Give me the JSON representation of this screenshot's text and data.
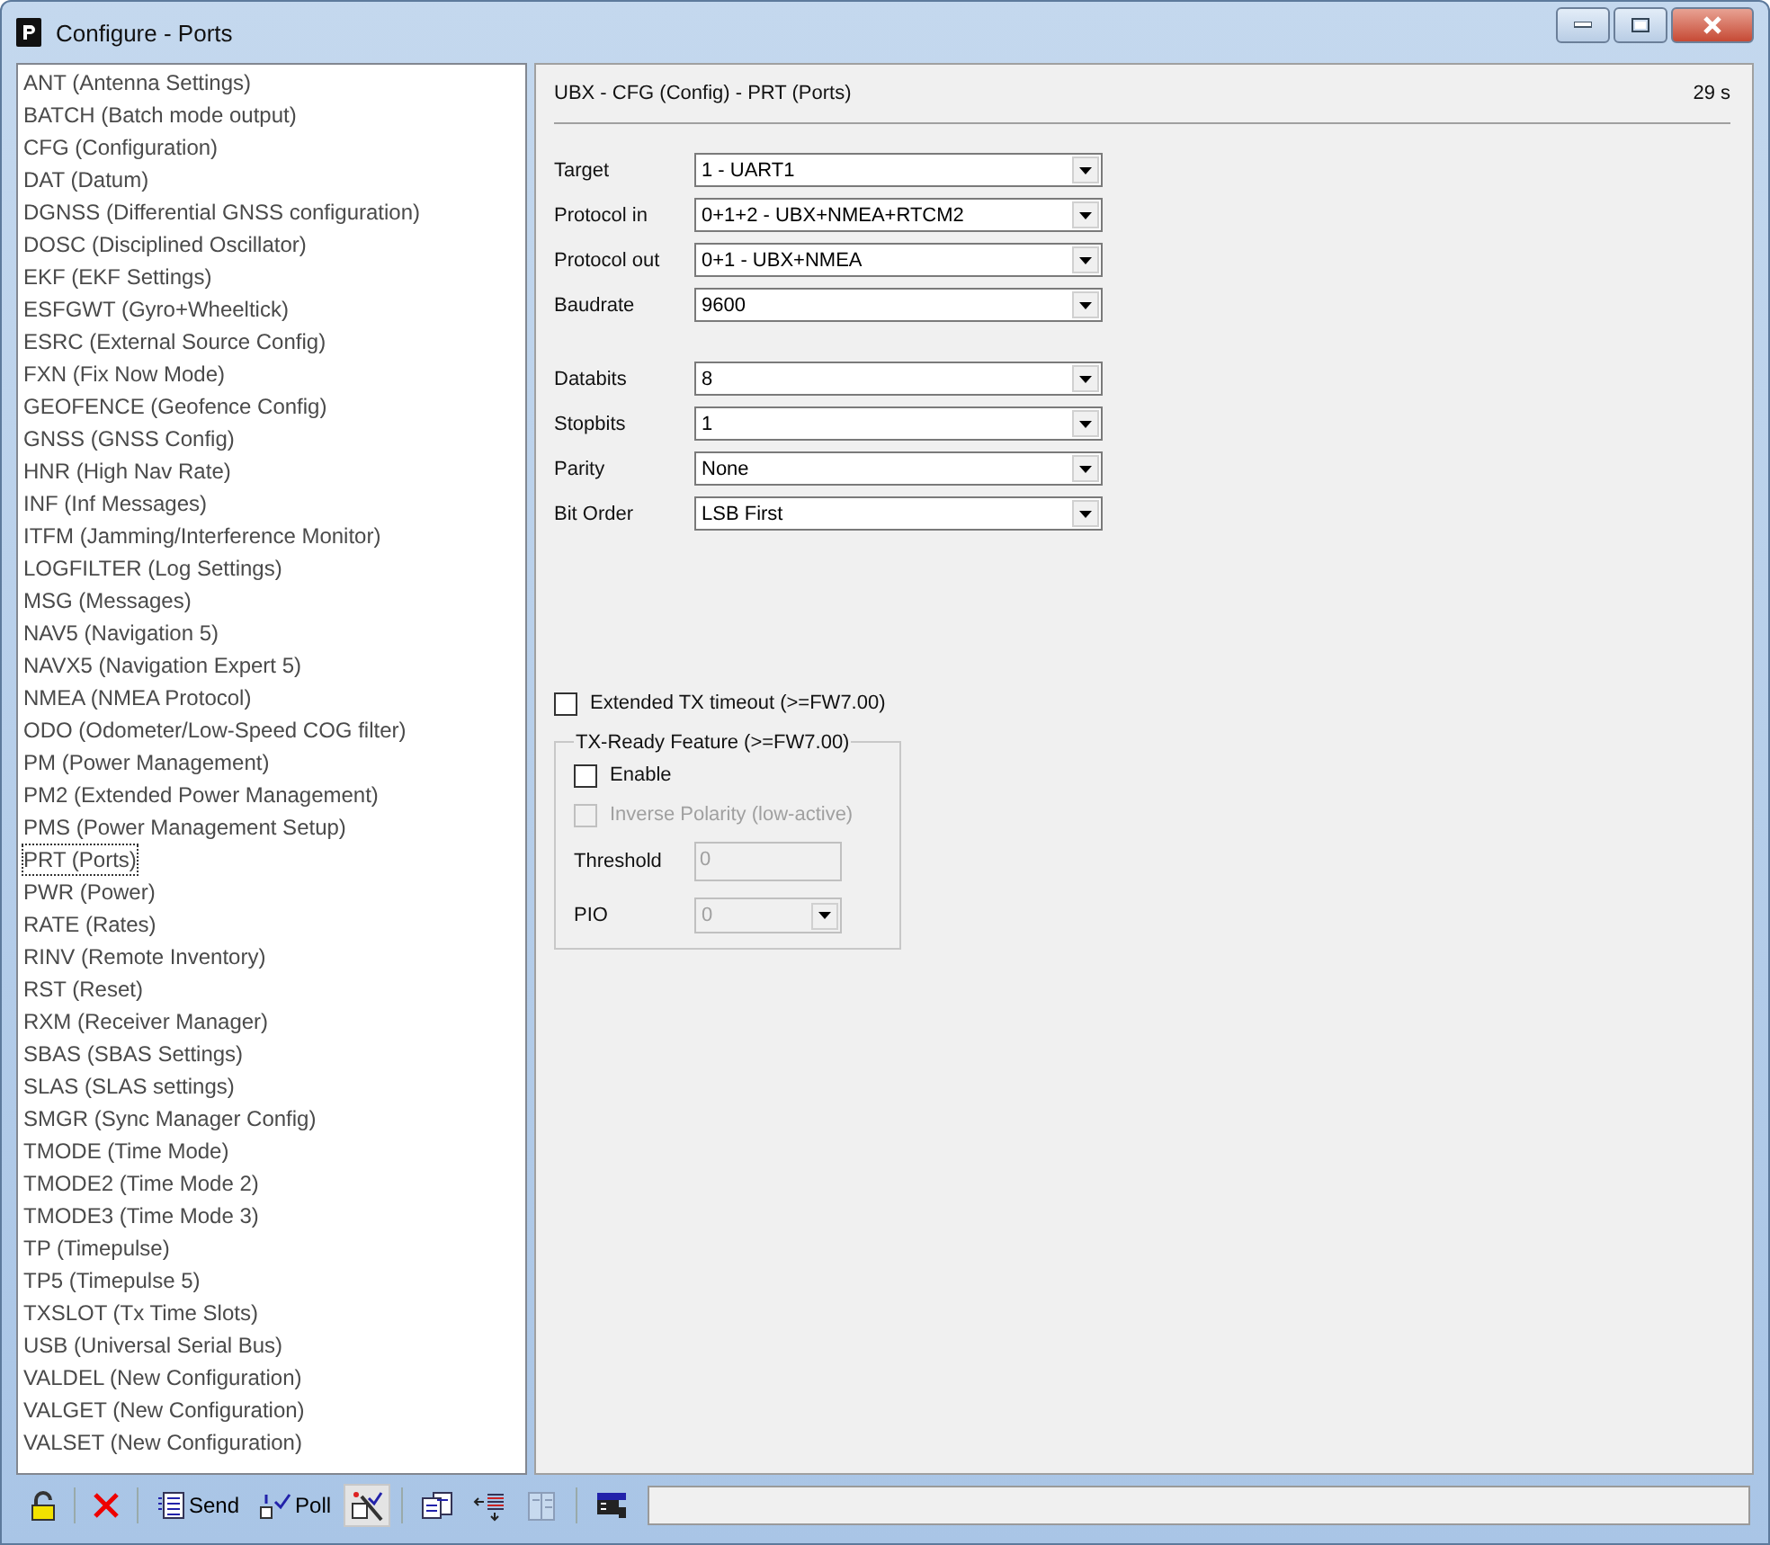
{
  "window": {
    "title": "Configure - Ports"
  },
  "sidebar": {
    "items": [
      {
        "label": "ANT (Antenna Settings)",
        "selected": false
      },
      {
        "label": "BATCH (Batch mode output)",
        "selected": false
      },
      {
        "label": "CFG (Configuration)",
        "selected": false
      },
      {
        "label": "DAT (Datum)",
        "selected": false
      },
      {
        "label": "DGNSS (Differential GNSS configuration)",
        "selected": false
      },
      {
        "label": "DOSC (Disciplined Oscillator)",
        "selected": false
      },
      {
        "label": "EKF (EKF Settings)",
        "selected": false
      },
      {
        "label": "ESFGWT (Gyro+Wheeltick)",
        "selected": false
      },
      {
        "label": "ESRC (External Source Config)",
        "selected": false
      },
      {
        "label": "FXN (Fix Now Mode)",
        "selected": false
      },
      {
        "label": "GEOFENCE (Geofence Config)",
        "selected": false
      },
      {
        "label": "GNSS (GNSS Config)",
        "selected": false
      },
      {
        "label": "HNR (High Nav Rate)",
        "selected": false
      },
      {
        "label": "INF (Inf Messages)",
        "selected": false
      },
      {
        "label": "ITFM (Jamming/Interference Monitor)",
        "selected": false
      },
      {
        "label": "LOGFILTER (Log Settings)",
        "selected": false
      },
      {
        "label": "MSG (Messages)",
        "selected": false
      },
      {
        "label": "NAV5 (Navigation 5)",
        "selected": false
      },
      {
        "label": "NAVX5 (Navigation Expert 5)",
        "selected": false
      },
      {
        "label": "NMEA (NMEA Protocol)",
        "selected": false
      },
      {
        "label": "ODO (Odometer/Low-Speed COG filter)",
        "selected": false
      },
      {
        "label": "PM (Power Management)",
        "selected": false
      },
      {
        "label": "PM2 (Extended Power Management)",
        "selected": false
      },
      {
        "label": "PMS (Power Management Setup)",
        "selected": false
      },
      {
        "label": "PRT (Ports)",
        "selected": true
      },
      {
        "label": "PWR (Power)",
        "selected": false
      },
      {
        "label": "RATE (Rates)",
        "selected": false
      },
      {
        "label": "RINV (Remote Inventory)",
        "selected": false
      },
      {
        "label": "RST (Reset)",
        "selected": false
      },
      {
        "label": "RXM (Receiver Manager)",
        "selected": false
      },
      {
        "label": "SBAS (SBAS Settings)",
        "selected": false
      },
      {
        "label": "SLAS (SLAS settings)",
        "selected": false
      },
      {
        "label": "SMGR (Sync Manager Config)",
        "selected": false
      },
      {
        "label": "TMODE (Time Mode)",
        "selected": false
      },
      {
        "label": "TMODE2 (Time Mode 2)",
        "selected": false
      },
      {
        "label": "TMODE3 (Time Mode 3)",
        "selected": false
      },
      {
        "label": "TP (Timepulse)",
        "selected": false
      },
      {
        "label": "TP5 (Timepulse 5)",
        "selected": false
      },
      {
        "label": "TXSLOT (Tx Time Slots)",
        "selected": false
      },
      {
        "label": "USB (Universal Serial Bus)",
        "selected": false
      },
      {
        "label": "VALDEL (New Configuration)",
        "selected": false
      },
      {
        "label": "VALGET (New Configuration)",
        "selected": false
      },
      {
        "label": "VALSET (New Configuration)",
        "selected": false
      }
    ]
  },
  "panel": {
    "heading": "UBX - CFG (Config) - PRT (Ports)",
    "age": "29 s",
    "field_groups": [
      [
        {
          "label": "Target",
          "value": "1 - UART1"
        },
        {
          "label": "Protocol in",
          "value": "0+1+2 - UBX+NMEA+RTCM2"
        },
        {
          "label": "Protocol out",
          "value": "0+1 - UBX+NMEA"
        },
        {
          "label": "Baudrate",
          "value": "9600"
        }
      ],
      [
        {
          "label": "Databits",
          "value": "8"
        },
        {
          "label": "Stopbits",
          "value": "1"
        },
        {
          "label": "Parity",
          "value": "None"
        },
        {
          "label": "Bit Order",
          "value": "LSB First"
        }
      ]
    ],
    "extended_tx_timeout": {
      "label": "Extended TX timeout (>=FW7.00)",
      "checked": false
    },
    "tx_ready": {
      "title": "TX-Ready Feature (>=FW7.00)",
      "enable": {
        "label": "Enable",
        "checked": false
      },
      "inverse_polarity": {
        "label": "Inverse Polarity (low-active)",
        "checked": false,
        "disabled": true
      },
      "threshold": {
        "label": "Threshold",
        "value": "0",
        "disabled": true
      },
      "pio": {
        "label": "PIO",
        "value": "0",
        "disabled": true
      }
    }
  },
  "toolbar": [
    {
      "kind": "lock",
      "pressed": false,
      "disabled": false
    },
    {
      "kind": "separator"
    },
    {
      "kind": "cancel",
      "pressed": false,
      "disabled": false
    },
    {
      "kind": "separator"
    },
    {
      "kind": "send",
      "label": "Send",
      "pressed": false,
      "disabled": false
    },
    {
      "kind": "poll",
      "label": "Poll",
      "pressed": false,
      "disabled": false
    },
    {
      "kind": "wand",
      "pressed": true,
      "disabled": false
    },
    {
      "kind": "separator"
    },
    {
      "kind": "copy",
      "pressed": false,
      "disabled": false
    },
    {
      "kind": "load",
      "pressed": false,
      "disabled": false
    },
    {
      "kind": "save",
      "pressed": false,
      "disabled": true
    },
    {
      "kind": "separator"
    },
    {
      "kind": "print",
      "pressed": false,
      "disabled": false
    }
  ]
}
